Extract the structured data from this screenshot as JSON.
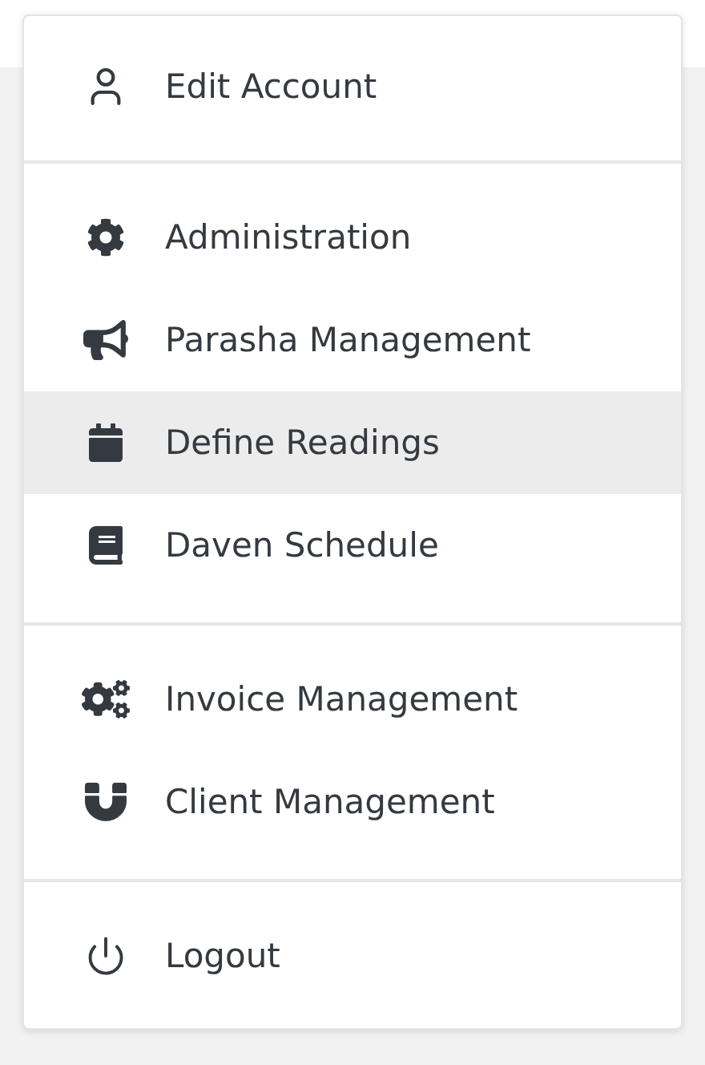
{
  "menu": {
    "sections": [
      {
        "items": [
          {
            "label": "Edit Account",
            "selected": false
          }
        ]
      },
      {
        "items": [
          {
            "label": "Administration",
            "selected": false
          },
          {
            "label": "Parasha Management",
            "selected": false
          },
          {
            "label": "Define Readings",
            "selected": true
          },
          {
            "label": "Daven Schedule",
            "selected": false
          }
        ]
      },
      {
        "items": [
          {
            "label": "Invoice Management",
            "selected": false
          },
          {
            "label": "Client Management",
            "selected": false
          }
        ]
      },
      {
        "items": [
          {
            "label": "Logout",
            "selected": false
          }
        ]
      }
    ]
  }
}
